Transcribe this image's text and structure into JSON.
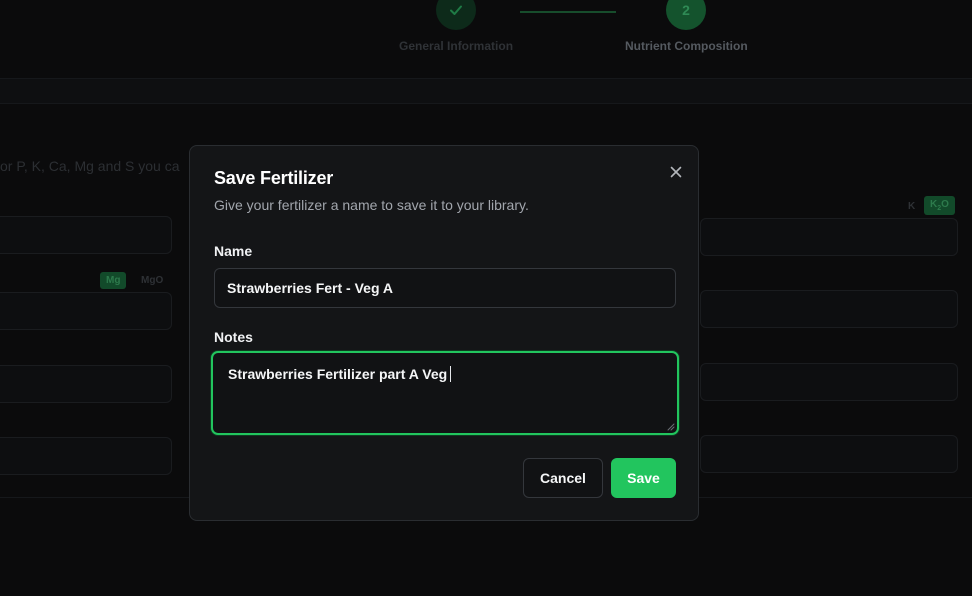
{
  "stepper": {
    "steps": [
      {
        "label": "General Information",
        "state": "completed"
      },
      {
        "label": "Nutrient Composition",
        "number": "2",
        "state": "active"
      }
    ]
  },
  "background": {
    "hint_text": "or P, K, Ca, Mg and S you ca",
    "chips": {
      "k": "K",
      "k2o_prefix": "K",
      "k2o_sub": "2",
      "k2o_suffix": "O",
      "mg": "Mg",
      "mgo": "MgO"
    }
  },
  "dialog": {
    "title": "Save Fertilizer",
    "description": "Give your fertilizer a name to save it to your library.",
    "close_icon": "close-icon",
    "name_label": "Name",
    "name_value": "Strawberries Fert - Veg A",
    "notes_label": "Notes",
    "notes_value": "Strawberries Fertilizer part A Veg",
    "cancel_label": "Cancel",
    "save_label": "Save"
  },
  "colors": {
    "accent": "#22c55e",
    "modal_bg": "#141517",
    "page_bg": "#0b0b0c"
  }
}
